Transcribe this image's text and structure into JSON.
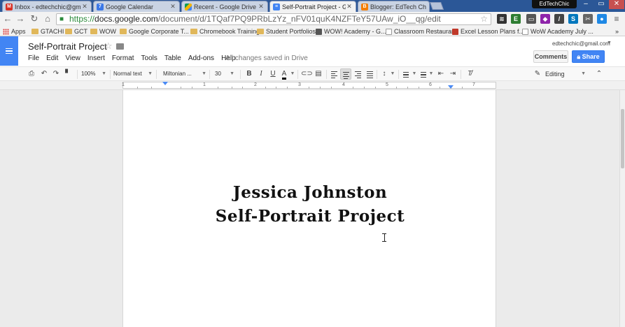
{
  "browser": {
    "tabs": [
      {
        "title": "Inbox - edtechchic@gmai",
        "icon": "gmail-icon",
        "active": false
      },
      {
        "title": "Google Calendar",
        "icon": "calendar-icon",
        "active": false
      },
      {
        "title": "Recent - Google Drive",
        "icon": "drive-icon",
        "active": false
      },
      {
        "title": "Self-Portrait Project - Goo",
        "icon": "docs-icon",
        "active": true
      },
      {
        "title": "Blogger: EdTech Chic - Ed",
        "icon": "blogger-icon",
        "active": false
      }
    ],
    "profile_name": "EdTechChic",
    "url_scheme": "https://",
    "url_host": "docs.google.com",
    "url_path": "/document/d/1TQaf7PQ9PRbLzYz_nFV01quK4NZFTeY57UAw_iO__qg/edit",
    "bookmarks": [
      {
        "label": "Apps",
        "type": "apps"
      },
      {
        "label": "GTACHI",
        "type": "folder"
      },
      {
        "label": "GCT",
        "type": "folder"
      },
      {
        "label": "WOW",
        "type": "folder"
      },
      {
        "label": "Google Corporate T...",
        "type": "folder"
      },
      {
        "label": "Chromebook Training",
        "type": "folder"
      },
      {
        "label": "Student Portfolios",
        "type": "folder"
      },
      {
        "label": "WOW! Academy - G...",
        "type": "page"
      },
      {
        "label": "Classroom Restaurant",
        "type": "page"
      },
      {
        "label": "Excel Lesson Plans f...",
        "type": "page"
      },
      {
        "label": "WoW Academy July ...",
        "type": "page"
      }
    ],
    "more_bookmarks": "»"
  },
  "docs": {
    "title": "Self-Portrait Project",
    "menu": [
      "File",
      "Edit",
      "View",
      "Insert",
      "Format",
      "Tools",
      "Table",
      "Add-ons",
      "Help"
    ],
    "save_status": "All changes saved in Drive",
    "account": "edtechchic@gmail.com",
    "comments_label": "Comments",
    "share_label": "Share",
    "toolbar": {
      "zoom": "100%",
      "style": "Normal text",
      "font": "Miltonian ...",
      "size": "30",
      "mode": "Editing"
    },
    "ruler_numbers": [
      "1",
      "1",
      "2",
      "3",
      "4",
      "5",
      "6",
      "7"
    ],
    "content": {
      "line1": "Jessica Johnston",
      "line2": "Self-Portrait Project"
    }
  },
  "colors": {
    "tabstrip": "#2b5797",
    "docs_blue": "#4285f4",
    "share_blue": "#4285f4",
    "secure_green": "#2a8a3a"
  }
}
